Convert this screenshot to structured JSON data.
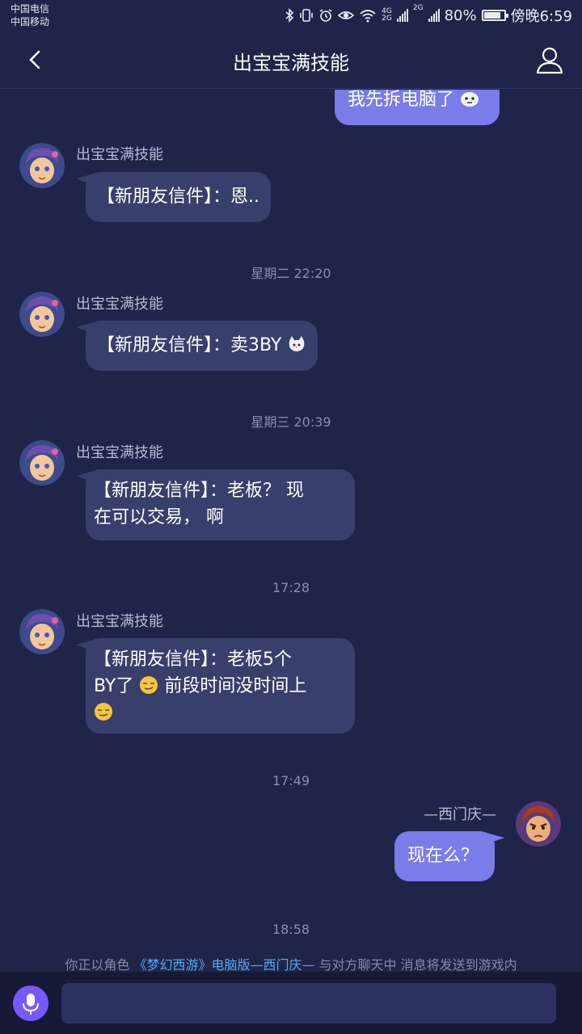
{
  "status_bar": {
    "carrier_1": "中国电信",
    "carrier_2": "中国移动",
    "network_1": "4G",
    "network_2": "2G",
    "battery": "80%",
    "battery_level": 0.8,
    "time": "傍晚6:59"
  },
  "header": {
    "title": "出宝宝满技能",
    "back_icon": "chevron-left-icon",
    "profile_icon": "user-icon"
  },
  "messages": [
    {
      "side": "right",
      "text": "我先拆电脑了",
      "emoji": "face-emoji"
    },
    {
      "side": "left",
      "sender": "出宝宝满技能",
      "text": "【新朋友信件】：恩.."
    },
    {
      "timestamp": "星期二 22:20"
    },
    {
      "side": "left",
      "sender": "出宝宝满技能",
      "text": "【新朋友信件】：卖3BY",
      "emoji": "cat-emoji"
    },
    {
      "timestamp": "星期三 20:39"
    },
    {
      "side": "left",
      "sender": "出宝宝满技能",
      "line1": "【新朋友信件】：老板？ 现",
      "line2": "在可以交易， 啊"
    },
    {
      "timestamp": "17:28"
    },
    {
      "side": "left",
      "sender": "出宝宝满技能",
      "line1": "【新朋友信件】：老板5个",
      "line2a": "BY了",
      "line2b": " 前段时间没时间上",
      "emoji": "smirk-emoji"
    },
    {
      "timestamp": "17:49"
    },
    {
      "side": "right",
      "sender": "—西门庆—",
      "text": "现在么？"
    },
    {
      "timestamp": "18:58"
    }
  ],
  "notice": {
    "prefix": "你正以角色 ",
    "highlight": "《梦幻西游》电脑版—西门庆—",
    "suffix": " 与对方聊天中 消息将发送到游戏内"
  },
  "input_bar": {
    "mic_icon": "microphone-icon",
    "placeholder": ""
  },
  "colors": {
    "background": "#1f2448",
    "incoming_bubble": "#393f6b",
    "outgoing_bubble": "#7a7ce9",
    "mic_button": "#7a58ff",
    "link": "#55aaf5"
  }
}
